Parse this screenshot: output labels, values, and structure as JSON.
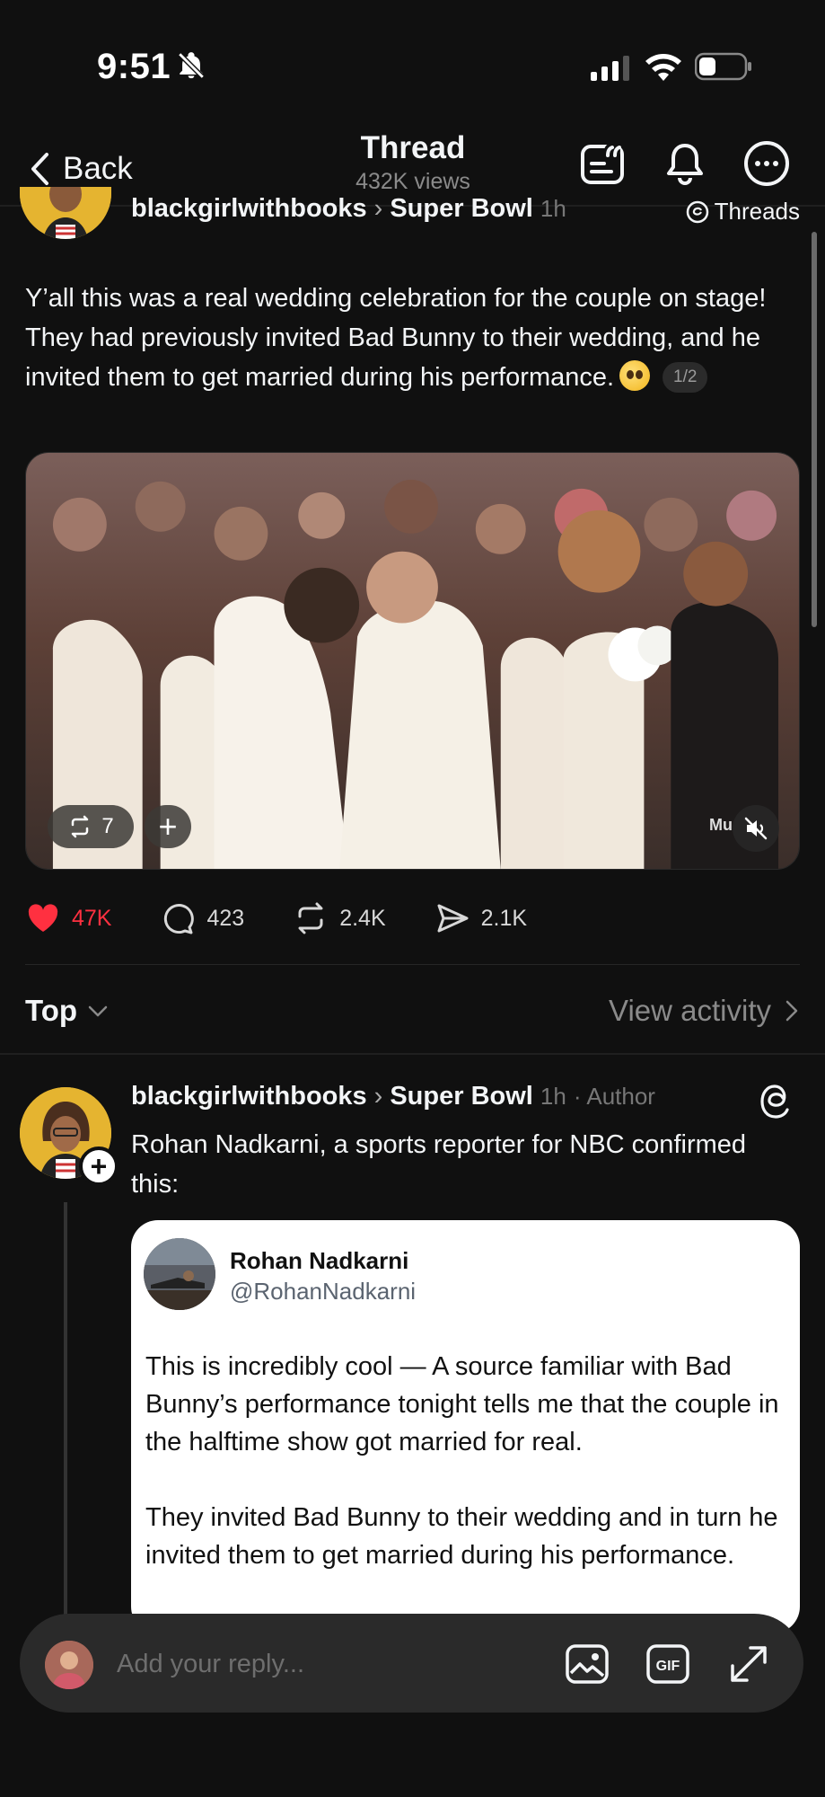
{
  "status_bar": {
    "time": "9:51"
  },
  "header": {
    "back_label": "Back",
    "title": "Thread",
    "views": "432K views"
  },
  "post": {
    "author": "blackgirlwithbooks",
    "community": "Super Bowl",
    "time": "1h",
    "source_tag": "Threads",
    "text": "Y’all this was a real wedding celebration for the couple on stage! They had previously invited Bad Bunny to their wedding, and he invited them to get married during his performance.",
    "page_badge": "1/2",
    "video": {
      "repost_count": "7",
      "logo_text": "Mu"
    },
    "actions": {
      "likes": "47K",
      "comments": "423",
      "reposts": "2.4K",
      "shares": "2.1K"
    }
  },
  "sort": {
    "label": "Top",
    "view_activity": "View activity"
  },
  "reply": {
    "author": "blackgirlwithbooks",
    "community": "Super Bowl",
    "time": "1h",
    "author_tag": "· Author",
    "text": "Rohan Nadkarni, a sports reporter for NBC confirmed this:",
    "quote": {
      "name": "Rohan Nadkarni",
      "handle": "@RohanNadkarni",
      "paragraph_1": "This is incredibly cool — A source familiar with Bad Bunny’s performance tonight tells me that the couple in the halftime show got married for real.",
      "paragraph_2": "They invited Bad Bunny to their wedding and in turn he invited them to get married during his performance."
    }
  },
  "reply_bar": {
    "placeholder": "Add your reply..."
  },
  "colors": {
    "background": "#101010",
    "like": "#ff3040",
    "avatar_yellow": "#e5b430"
  }
}
